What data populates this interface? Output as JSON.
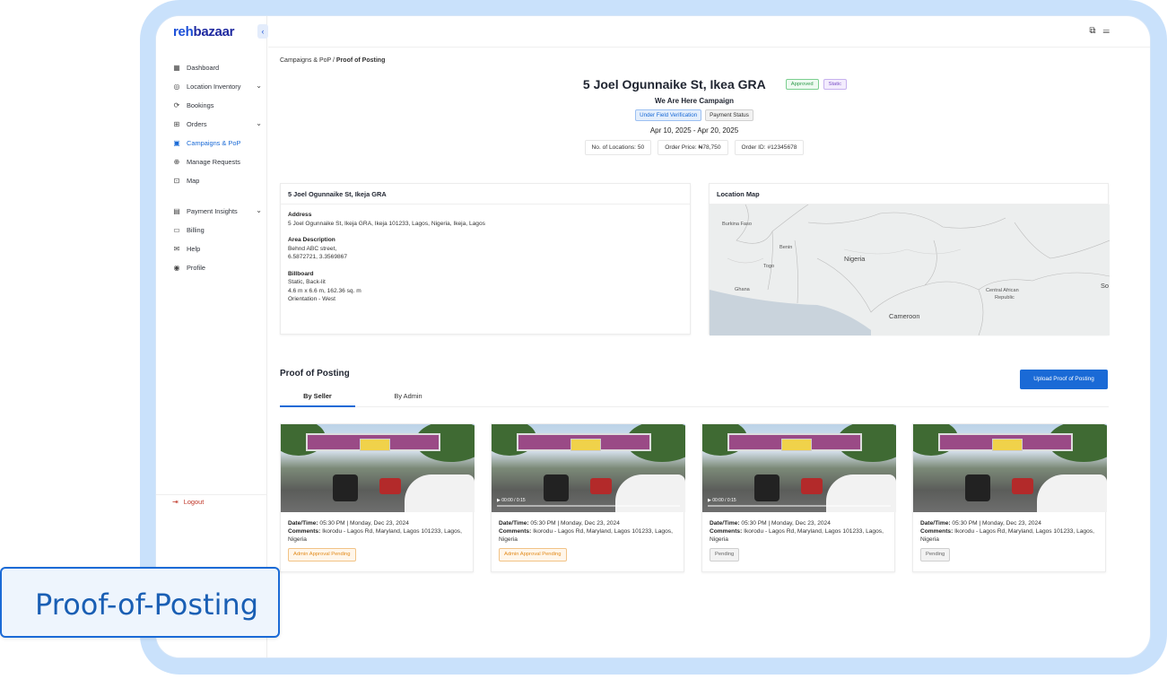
{
  "brand": {
    "logo_part1": "reh",
    "logo_part2": "bazaar"
  },
  "sidebar": {
    "items": [
      {
        "label": "Dashboard",
        "icon": "grid-icon"
      },
      {
        "label": "Location Inventory",
        "icon": "location-icon"
      },
      {
        "label": "Bookings",
        "icon": "bookings-icon"
      },
      {
        "label": "Orders",
        "icon": "orders-icon"
      },
      {
        "label": "Campaigns & PoP",
        "icon": "campaigns-icon"
      },
      {
        "label": "Manage Requests",
        "icon": "requests-icon"
      },
      {
        "label": "Map",
        "icon": "map-icon"
      },
      {
        "label": "Payment Insights",
        "icon": "payment-icon"
      },
      {
        "label": "Billing",
        "icon": "billing-icon"
      },
      {
        "label": "Help",
        "icon": "help-icon"
      },
      {
        "label": "Profile",
        "icon": "profile-icon"
      }
    ],
    "logout": "Logout"
  },
  "breadcrumb": {
    "parent": "Campaigns & PoP / ",
    "current": "Proof of Posting"
  },
  "header": {
    "title": "5 Joel Ogunnaike St, Ikea GRA",
    "badge_approved": "Approved",
    "badge_static": "Static",
    "campaign": "We Are Here Campaign",
    "status_field": "Under Field Verification",
    "status_payment": "Payment Status",
    "date_range": "Apr 10, 2025 - Apr 20, 2025",
    "locations": "No. of Locations: 50",
    "price": "Order Price: ₦78,750",
    "order_id": "Order ID: #12345678"
  },
  "details": {
    "title": "5 Joel Ogunnaike St, Ikeja GRA",
    "address_label": "Address",
    "address": "5 Joel Ogunnaike St, Ikeja GRA, Ikeja 101233, Lagos, Nigeria, Ikeja, Lagos",
    "area_label": "Area Description",
    "area_line1": "Behnd ABC street,",
    "area_line2": "6.5872721, 3.3569867",
    "billboard_label": "Billboard",
    "bb_line1": "Static, Back-lit",
    "bb_line2": "4.6 m x 6.6 m, 162.36 sq. m",
    "bb_line3": "Orientation - West"
  },
  "map": {
    "title": "Location Map",
    "labels": {
      "burkina": "Burkina Faso",
      "benin": "Benin",
      "nigeria": "Nigeria",
      "togo": "Togo",
      "ghana": "Ghana",
      "car1": "Central African",
      "car2": "Republic",
      "cameroon": "Cameroon",
      "so": "So"
    }
  },
  "pop": {
    "title": "Proof of Posting",
    "upload_button": "Upload Proof of Posting",
    "tab_seller": "By Seller",
    "tab_admin": "By Admin",
    "cards": [
      {
        "datetime_label": "Date/Time:",
        "datetime": " 05:30 PM | Monday, Dec 23, 2024",
        "comments_label": "Comments:",
        "comments": " Ikorodu - Lagos Rd, Maryland, Lagos 101233, Lagos, Nigeria",
        "status": "Admin Approval Pending",
        "video_time": ""
      },
      {
        "datetime_label": "Date/Time:",
        "datetime": " 05:30 PM | Monday, Dec 23, 2024",
        "comments_label": "Comments:",
        "comments": " Ikorodu - Lagos Rd, Maryland, Lagos 101233, Lagos, Nigeria",
        "status": "Admin Approval Pending",
        "video_time": "▶ 00:00 / 0:15"
      },
      {
        "datetime_label": "Date/Time:",
        "datetime": " 05:30 PM | Monday, Dec 23, 2024",
        "comments_label": "Comments:",
        "comments": " Ikorodu - Lagos Rd, Maryland, Lagos 101233, Lagos, Nigeria",
        "status": "Pending",
        "video_time": "▶ 00:00 / 0:15"
      },
      {
        "datetime_label": "Date/Time:",
        "datetime": " 05:30 PM | Monday, Dec 23, 2024",
        "comments_label": "Comments:",
        "comments": " Ikorodu - Lagos Rd, Maryland, Lagos 101233, Lagos, Nigeria",
        "status": "Pending",
        "video_time": ""
      }
    ]
  },
  "callout": {
    "label": "Proof-of-Posting"
  },
  "colors": {
    "accent": "#1a6ad6",
    "frame": "#c9e1fb"
  }
}
